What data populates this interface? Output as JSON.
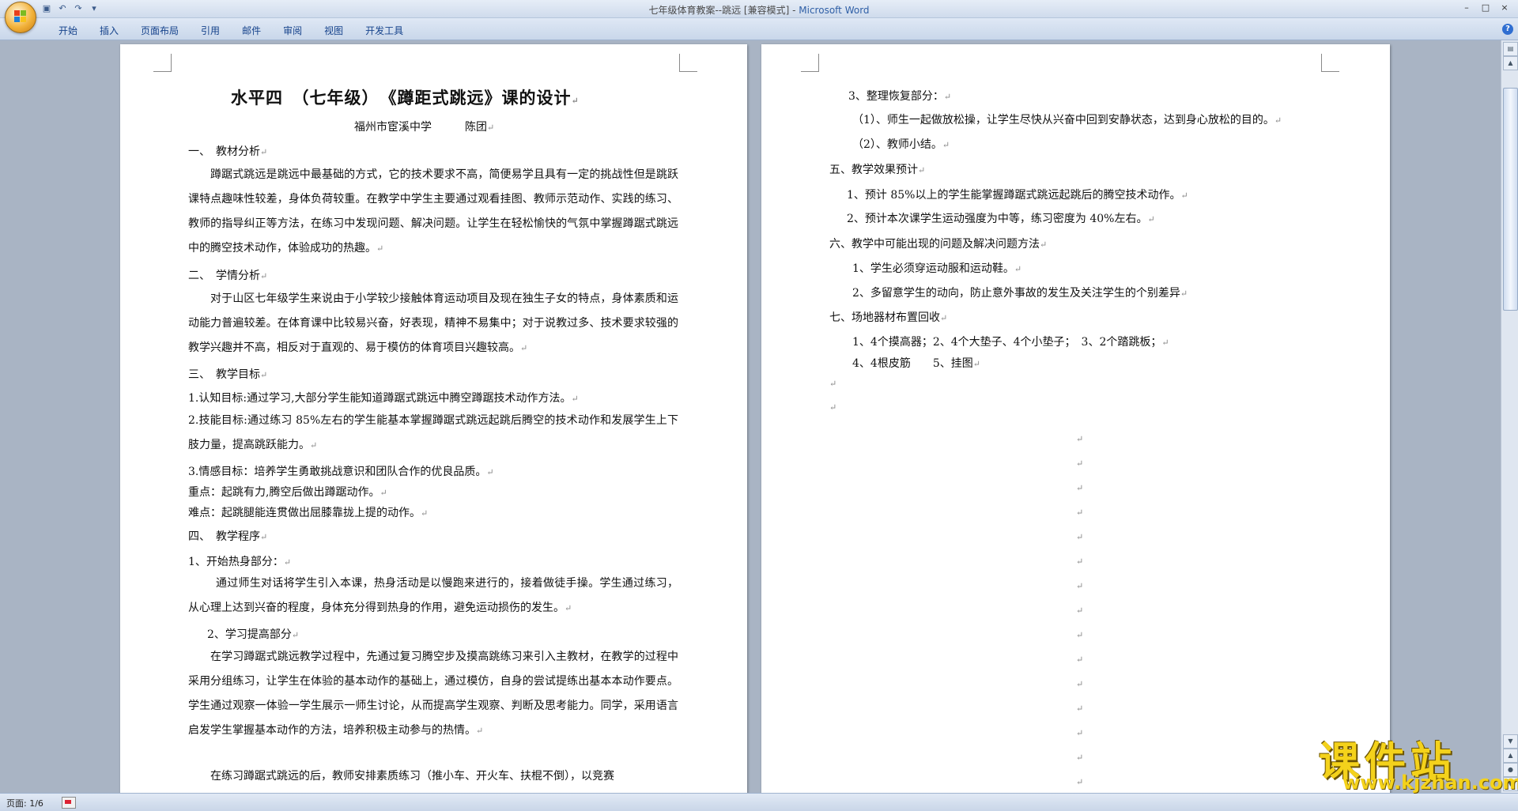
{
  "window": {
    "title_doc": "七年级体育教案--跳远 [兼容模式] - ",
    "title_app": "Microsoft Word",
    "controls": [
      "–",
      "□",
      "×"
    ]
  },
  "quick_access": {
    "save_icon": "save-icon",
    "undo_icon": "undo-icon",
    "redo_icon": "redo-icon",
    "customize_icon": "dropdown-icon"
  },
  "ribbon": {
    "tabs": [
      "开始",
      "插入",
      "页面布局",
      "引用",
      "邮件",
      "审阅",
      "视图",
      "开发工具"
    ],
    "help": "?"
  },
  "left_page": {
    "title": "水平四　（七年级）　《蹲距式跳远》课的设计",
    "author_line": "福州市宦溪中学　　　陈团",
    "s1_heading": "一、　教材分析",
    "s1_body": "蹲踞式跳远是跳远中最基础的方式，它的技术要求不高，简便易学且具有一定的挑战性但是跳跃课特点趣味性较差，身体负荷较重。在教学中学生主要通过观看挂图、教师示范动作、实践的练习、教师的指导纠正等方法，在练习中发现问题、解决问题。让学生在轻松愉快的气氛中掌握蹲踞式跳远中的腾空技术动作，体验成功的热趣。",
    "s2_heading": "二、　学情分析",
    "s2_body": "对于山区七年级学生来说由于小学较少接触体育运动项目及现在独生子女的特点，身体素质和运动能力普遍较差。在体育课中比较易兴奋，好表现，精神不易集中；对于说教过多、技术要求较强的教学兴趣并不高，相反对于直观的、易于模仿的体育项目兴趣较高。",
    "s3_heading": "三、　教学目标",
    "goal1": "1.认知目标:通过学习,大部分学生能知道蹲踞式跳远中腾空蹲踞技术动作方法。",
    "goal2": "2.技能目标:通过练习 85%左右的学生能基本掌握蹲踞式跳远起跳后腾空的技术动作和发展学生上下肢力量，提高跳跃能力。",
    "goal3": "3.情感目标：培养学生勇敢挑战意识和团队合作的优良品质。",
    "key_point": "重点：起跳有力,腾空后做出蹲踞动作。",
    "difficulty": "难点：起跳腿能连贯做出屈膝靠拢上提的动作。",
    "s4_heading": "四、　教学程序",
    "step1": "1、开始热身部分：",
    "step1_body": "通过师生对话将学生引入本课，热身活动是以慢跑来进行的，接着做徒手操。学生通过练习，从心理上达到兴奋的程度，身体充分得到热身的作用，避免运动损伤的发生。",
    "step2": "2、学习提高部分",
    "step2_body": "在学习蹲踞式跳远教学过程中，先通过复习腾空步及摸高跳练习来引入主教材，在教学的过程中采用分组练习，让学生在体验的基本动作的基础上，通过模仿，自身的尝试提练出基本本动作要点。学生通过观察一体验一学生展示一师生讨论，从而提高学生观察、判断及思考能力。同学，采用语言启发学生掌握基本动作的方法，培养积极主动参与的热情。",
    "step2_body2": "在练习蹲踞式跳远的后，教师安排素质练习（推小车、开火车、扶棍不倒），以竞赛"
  },
  "right_page": {
    "r1": "3、整理恢复部分：",
    "r2": "（1）、师生一起做放松操，让学生尽快从兴奋中回到安静状态，达到身心放松的目的。",
    "r3": "（2）、教师小结。",
    "r4": "五、教学效果预计",
    "r5": "1、预计 85%以上的学生能掌握蹲踞式跳远起跳后的腾空技术动作。",
    "r6": "2、预计本次课学生运动强度为中等，练习密度为 40%左右。",
    "r7": "六、教学中可能出现的问题及解决问题方法",
    "r8": "1、学生必须穿运动服和运动鞋。",
    "r9": "2、多留意学生的动向，防止意外事故的发生及关注学生的个别差异",
    "r10": "七、场地器材布置回收",
    "r11": "1、4个摸高器；2、4个大垫子、4个小垫子；　3、2个踏跳板；",
    "r12": "4、4根皮筋　　5、挂图"
  },
  "paragraph_mark": "↵",
  "status": {
    "page": "页面: 1/6"
  },
  "watermark": {
    "text": "课件站",
    "url": "www.kjzhan.com"
  }
}
